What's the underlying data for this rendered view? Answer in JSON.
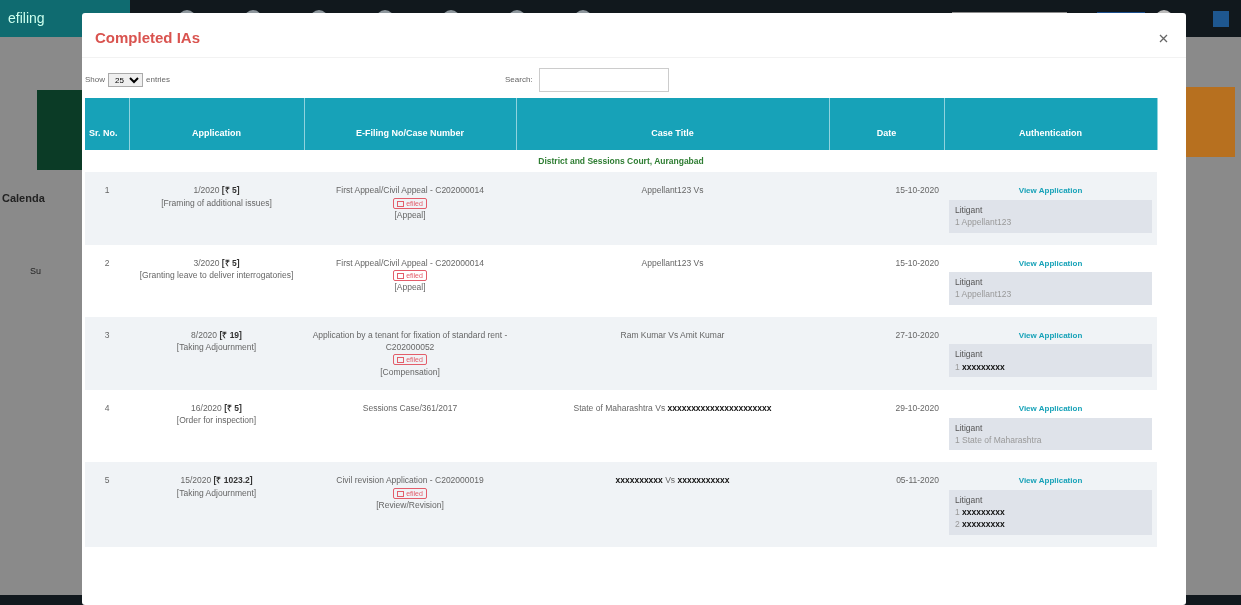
{
  "background": {
    "brand": "efiling",
    "sidebar_heading": "Calenda",
    "weekday": "Su"
  },
  "modal": {
    "title": "Completed IAs",
    "length_menu": {
      "prefix": "Show",
      "value": "25",
      "suffix": "entries"
    },
    "search": {
      "label": "Search:"
    },
    "columns": [
      "Sr. No.",
      "Application",
      "E-Filing No/Case Number",
      "Case Title",
      "Date",
      "Authentication"
    ],
    "group_heading": "District and Sessions Court, Aurangabad",
    "rows": [
      {
        "sr": "1",
        "app_no": "1/2020",
        "fee": "[₹ 5]",
        "purpose": "[Framing of additional issues]",
        "case": "First Appeal/Civil Appeal - C202000014",
        "efiled": true,
        "efiled_label": "efiled",
        "case_type": "[Appeal]",
        "title": "Appellant123 Vs",
        "date": "15-10-2020",
        "link": "View Application",
        "litigant_label": "Litigant",
        "litigants": [
          "1 Appellant123"
        ]
      },
      {
        "sr": "2",
        "app_no": "3/2020",
        "fee": "[₹ 5]",
        "purpose": "[Granting leave to deliver interrogatories]",
        "case": "First Appeal/Civil Appeal - C202000014",
        "efiled": true,
        "efiled_label": "efiled",
        "case_type": "[Appeal]",
        "title": "Appellant123 Vs",
        "date": "15-10-2020",
        "link": "View Application",
        "litigant_label": "Litigant",
        "litigants": [
          "1 Appellant123"
        ]
      },
      {
        "sr": "3",
        "app_no": "8/2020",
        "fee": "[₹ 19]",
        "purpose": "[Taking Adjournment]",
        "case": "Application by a tenant for fixation of standard rent - C202000052",
        "efiled": true,
        "efiled_label": "efiled",
        "case_type": "[Compensation]",
        "title": "Ram Kumar Vs Amit Kumar",
        "date": "27-10-2020",
        "link": "View Application",
        "litigant_label": "Litigant",
        "litigants": [
          "1 **xxxxxxxxx**"
        ]
      },
      {
        "sr": "4",
        "app_no": "16/2020",
        "fee": "[₹ 5]",
        "purpose": "[Order for inspection]",
        "case": "Sessions Case/361/2017",
        "efiled": false,
        "title": "State of Maharashtra Vs **xxxxxxxxxxxxxxxxxxxxxx**",
        "date": "29-10-2020",
        "link": "View Application",
        "litigant_label": "Litigant",
        "litigants": [
          "1 State of Maharashtra"
        ]
      },
      {
        "sr": "5",
        "app_no": "15/2020",
        "fee": "[₹ 1023.2]",
        "purpose": "[Taking Adjournment]",
        "case": "Civil revision Application - C202000019",
        "efiled": true,
        "efiled_label": "efiled",
        "case_type": "[Review/Revision]",
        "title": "**xxxxxxxxxx** Vs **xxxxxxxxxxx**",
        "date": "05-11-2020",
        "link": "View Application",
        "litigant_label": "Litigant",
        "litigants": [
          "1 **xxxxxxxxx**",
          "2 **xxxxxxxxx**"
        ]
      }
    ]
  }
}
